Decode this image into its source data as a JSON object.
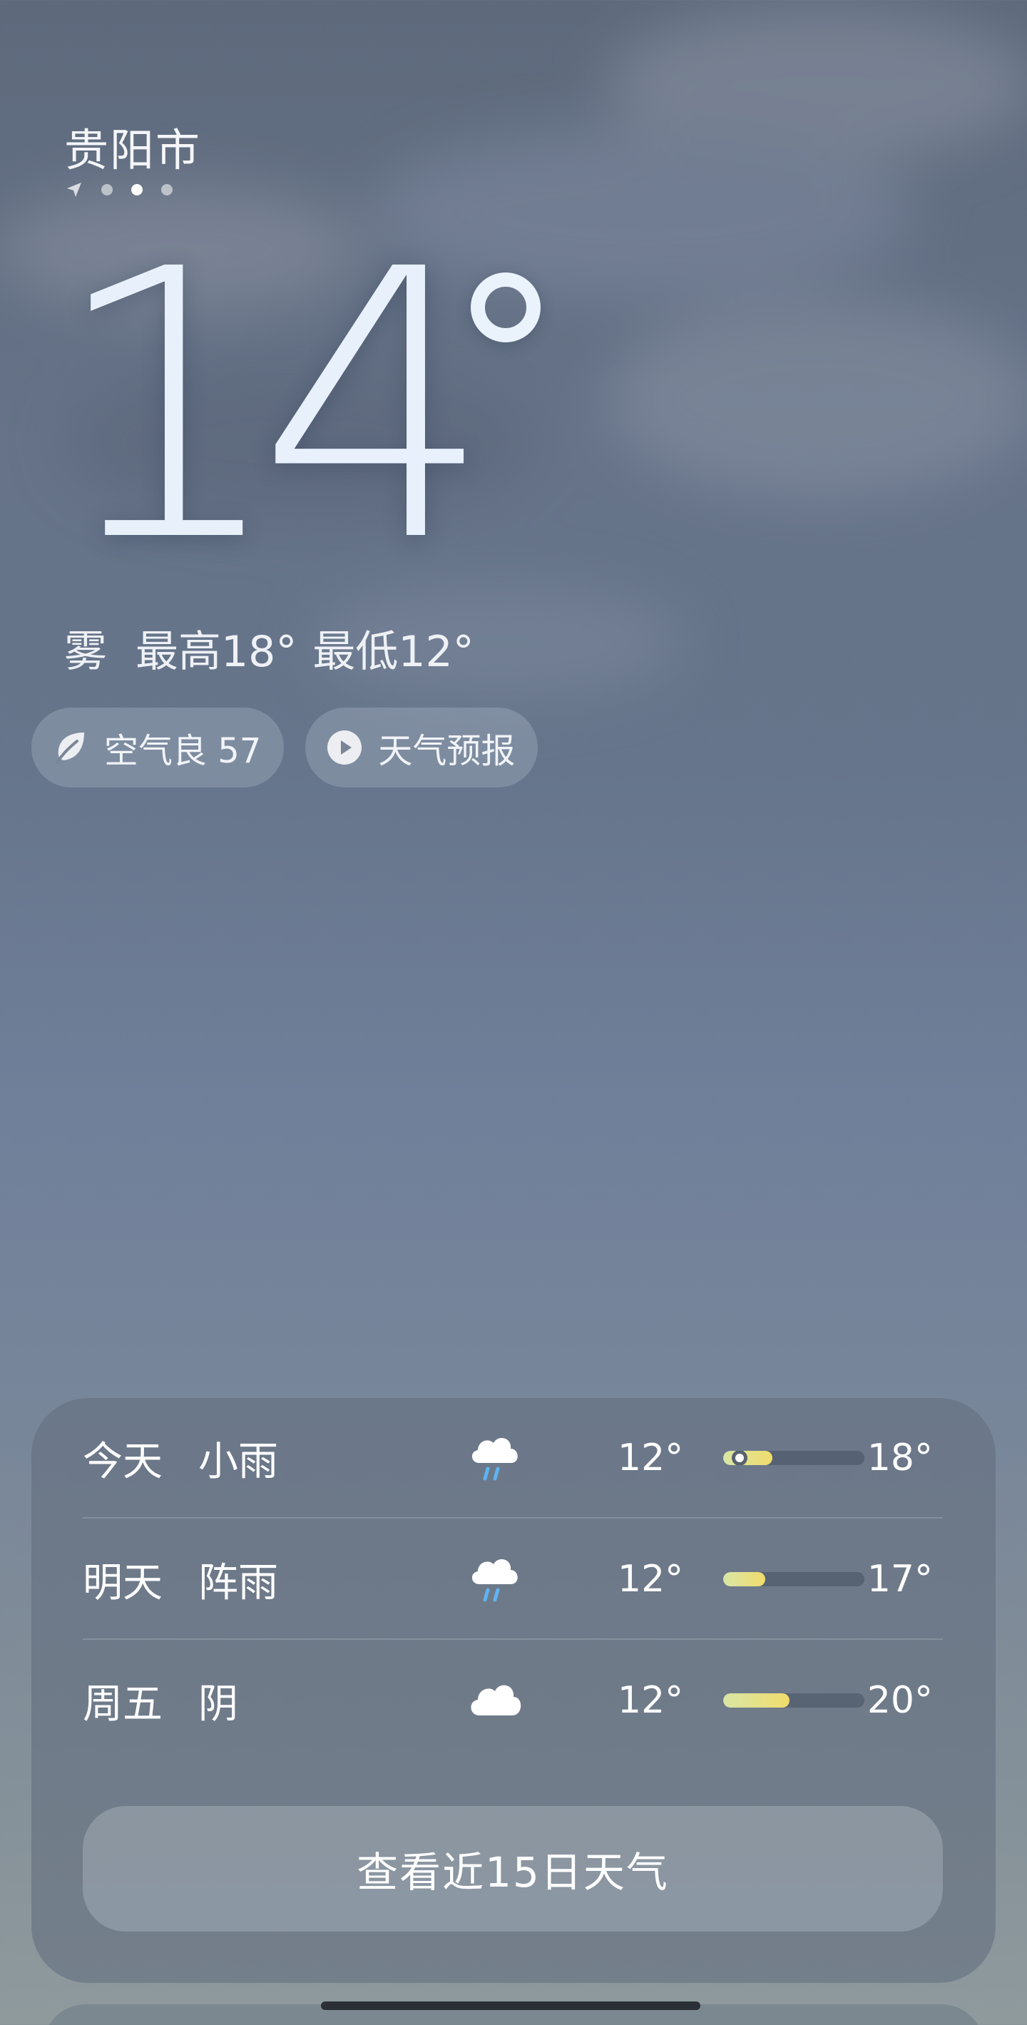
{
  "location": {
    "city": "贵阳市",
    "page_count": 4,
    "active_page": 2
  },
  "current": {
    "temperature": "14",
    "condition": "雾",
    "high_label": "最高18°",
    "low_label": "最低12°"
  },
  "chips": {
    "air_quality": "空气良 57",
    "forecast_video": "天气预报"
  },
  "forecast": {
    "days": [
      {
        "day": "今天",
        "condition": "小雨",
        "icon": "light-rain-icon",
        "low": "12°",
        "high": "18°",
        "bar_start": 0.0,
        "bar_end": 0.35,
        "current_marker": 0.12
      },
      {
        "day": "明天",
        "condition": "阵雨",
        "icon": "shower-rain-icon",
        "low": "12°",
        "high": "17°",
        "bar_start": 0.0,
        "bar_end": 0.3
      },
      {
        "day": "周五",
        "condition": "阴",
        "icon": "overcast-cloud-icon",
        "low": "12°",
        "high": "20°",
        "bar_start": 0.0,
        "bar_end": 0.47
      }
    ],
    "more_label": "查看近15日天气"
  },
  "colors": {
    "bar_fill_start": "#d8e6a6",
    "bar_fill_end": "#f1dc6c",
    "rain_drop": "#5fb4f2"
  }
}
